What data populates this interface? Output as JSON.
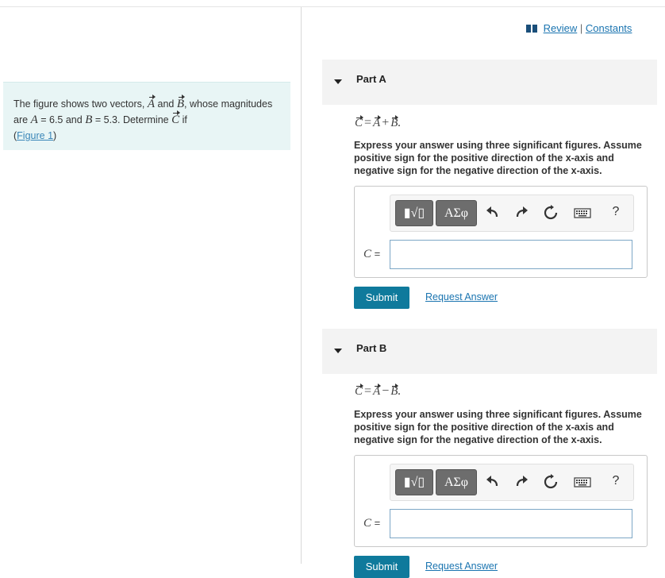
{
  "problem": {
    "text_prefix": "The figure shows two vectors,",
    "vector_a": "A",
    "and_word": "and",
    "vector_b": "B",
    "text_middle": ", whose magnitudes are",
    "a_symbol": "A",
    "a_value": "= 6.5 and",
    "b_symbol": "B",
    "b_value": "= 5.3. Determine",
    "vector_c": "C",
    "text_if": "if",
    "figure_link": "Figure 1"
  },
  "header_links": {
    "review": "Review",
    "separator": "|",
    "constants": "Constants"
  },
  "parts": [
    {
      "title": "Part A",
      "equation": {
        "lhs": "C",
        "eq": "=",
        "a": "A",
        "op": "+",
        "b": "B",
        "end": "."
      },
      "instructions": "Express your answer using three significant figures. Assume positive sign for the positive direction of the x-axis and negative sign for the negative direction of the x-axis.",
      "toolbar": {
        "template_label": "▮√▯",
        "greek_label": "ΑΣφ",
        "help_label": "?"
      },
      "answer_label": "C",
      "answer_eq": "=",
      "answer_value": "",
      "submit_label": "Submit",
      "request_label": "Request Answer"
    },
    {
      "title": "Part B",
      "equation": {
        "lhs": "C",
        "eq": "=",
        "a": "A",
        "op": "−",
        "b": "B",
        "end": "."
      },
      "instructions": "Express your answer using three significant figures. Assume positive sign for the positive direction of the x-axis and negative sign for the negative direction of the x-axis.",
      "toolbar": {
        "template_label": "▮√▯",
        "greek_label": "ΑΣφ",
        "help_label": "?"
      },
      "answer_label": "C",
      "answer_eq": "=",
      "answer_value": "",
      "submit_label": "Submit",
      "request_label": "Request Answer"
    }
  ],
  "icons": [
    "book-icon",
    "undo-icon",
    "redo-icon",
    "reset-icon",
    "keyboard-icon",
    "help-icon"
  ],
  "colors": {
    "accent": "#0f7a9c",
    "link": "#1a74b0",
    "problem_bg": "#e8f5f5"
  }
}
